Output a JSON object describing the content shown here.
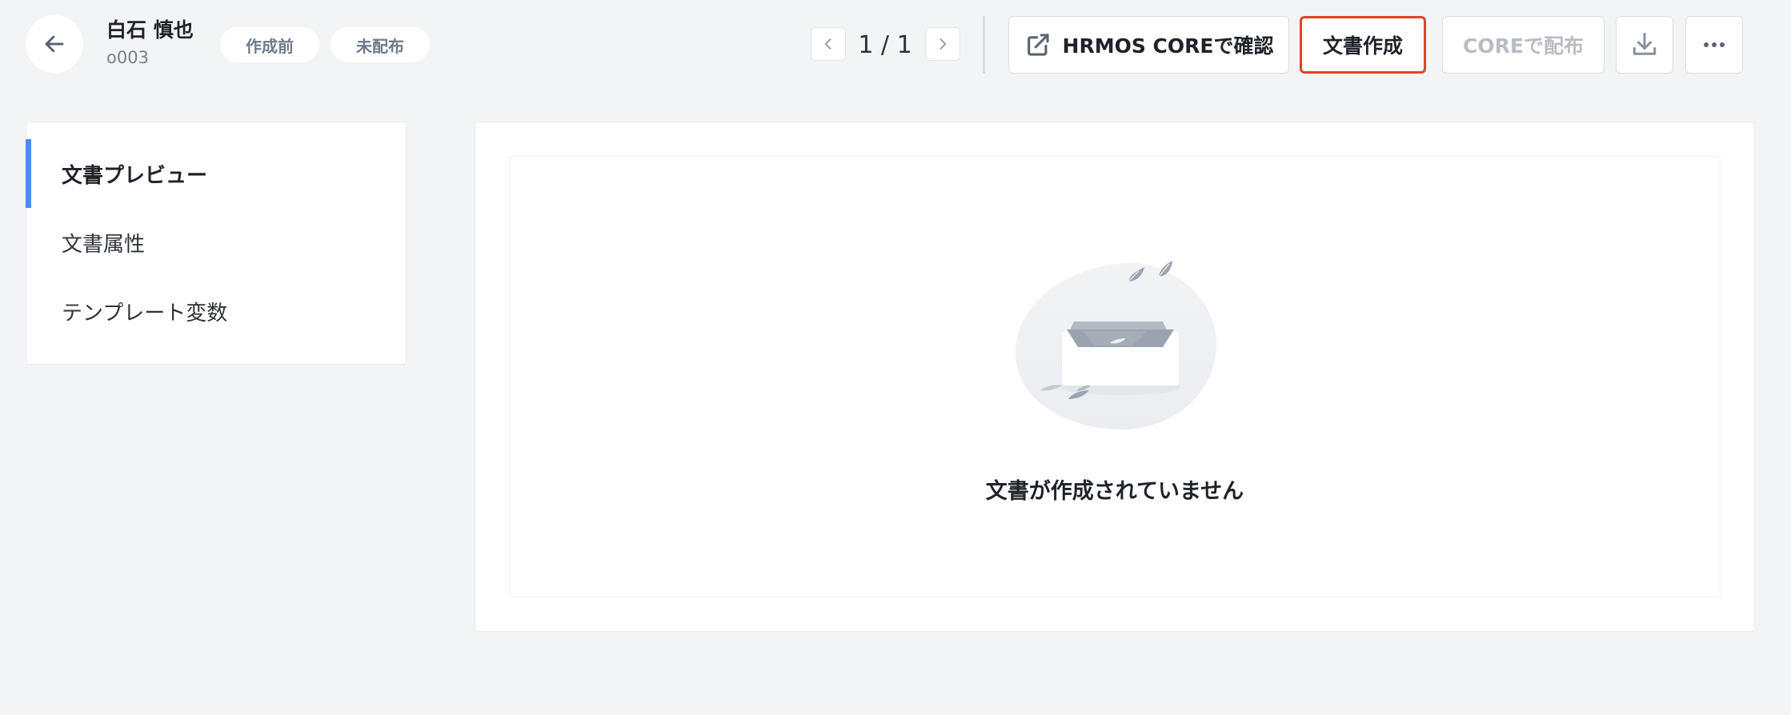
{
  "header": {
    "employee_name": "白石 慎也",
    "employee_id": "o003",
    "badges": [
      "作成前",
      "未配布"
    ],
    "pagination": "1 / 1"
  },
  "toolbar": {
    "hrmos_label": "HRMOS COREで確認",
    "create_label": "文書作成",
    "distribute_label": "COREで配布"
  },
  "sidebar": {
    "items": [
      {
        "label": "文書プレビュー",
        "active": true
      },
      {
        "label": "文書属性",
        "active": false
      },
      {
        "label": "テンプレート変数",
        "active": false
      }
    ]
  },
  "main": {
    "empty_message": "文書が作成されていません"
  },
  "colors": {
    "accent": "#4a8ef0",
    "highlight_border": "#e0442c",
    "background": "#f3f4f6",
    "badge_text": "#6f7b8a",
    "disabled_text": "#b9bdc2"
  },
  "icons": [
    "arrow-left-icon",
    "chevron-left-icon",
    "chevron-right-icon",
    "external-link-icon",
    "download-icon",
    "more-horizontal-icon",
    "empty-box-illustration"
  ]
}
